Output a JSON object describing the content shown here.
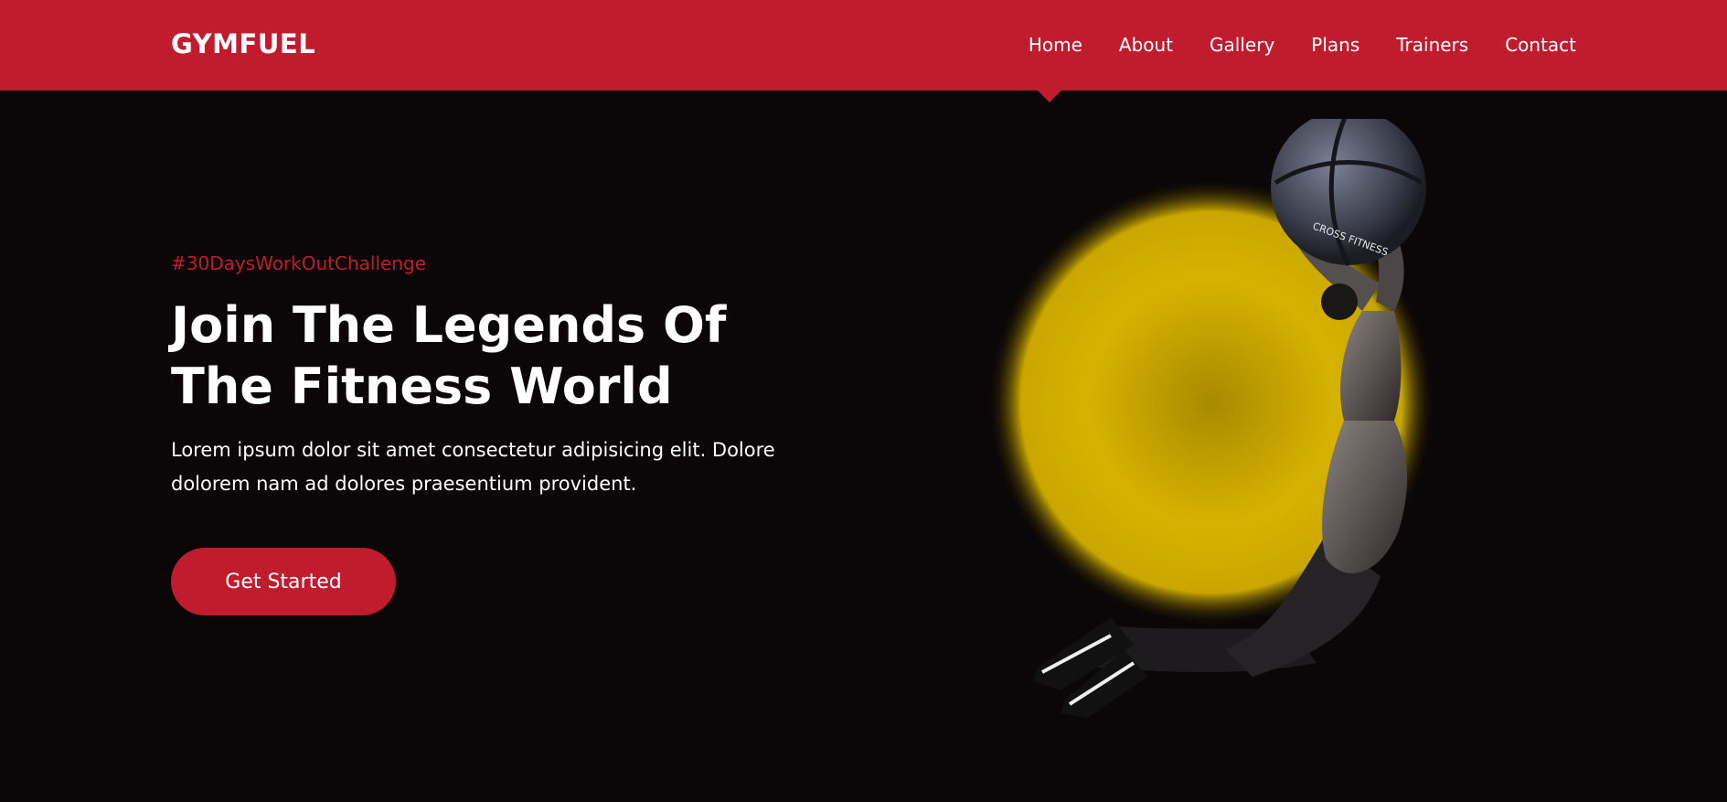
{
  "brand": {
    "name": "GYMFUEL"
  },
  "nav": {
    "items": [
      {
        "label": "Home",
        "active": true
      },
      {
        "label": "About"
      },
      {
        "label": "Gallery"
      },
      {
        "label": "Plans"
      },
      {
        "label": "Trainers"
      },
      {
        "label": "Contact"
      }
    ]
  },
  "hero": {
    "hashtag": "#30DaysWorkOutChallenge",
    "headline": "Join The Legends Of The Fitness World",
    "description": "Lorem ipsum dolor sit amet consectetur adipisicing elit. Dolore dolorem nam ad dolores praesentium provident.",
    "cta_label": "Get Started",
    "ball_text": "CROSS FITNESS"
  },
  "colors": {
    "primary": "#c11b2e",
    "background": "#0b0607",
    "accent_glow": "#d6b300",
    "text": "#ffffff"
  }
}
